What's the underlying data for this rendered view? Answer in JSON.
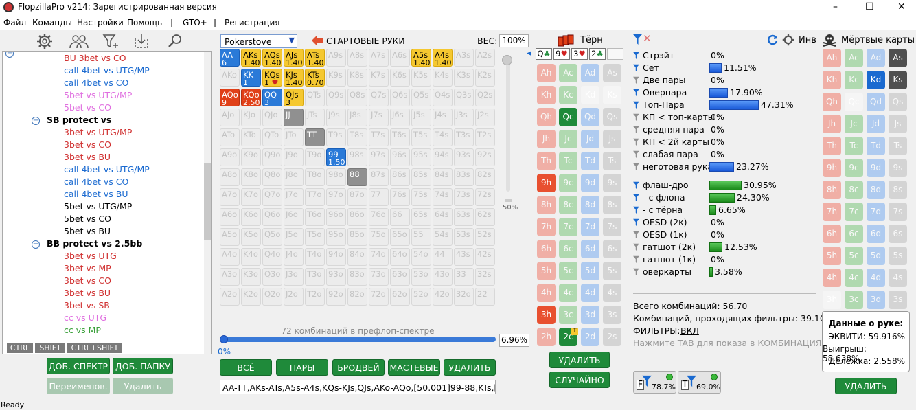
{
  "window": {
    "title": "FlopzillaPro v214: Зарегистрированная версия",
    "controls": [
      "–",
      "☐",
      "✕"
    ]
  },
  "menu": [
    "Файл",
    "Команды",
    "Настройки",
    "Помощь",
    "|",
    "GTO+",
    "|",
    "Регистрация"
  ],
  "tree": {
    "rows": [
      {
        "text": "BU 3bet vs CO",
        "color": "#d03030",
        "indent": 2
      },
      {
        "text": "call 4bet vs UTG/MP",
        "color": "#1a6ad0",
        "indent": 2
      },
      {
        "text": "call 4bet vs CO",
        "color": "#1a6ad0",
        "indent": 2
      },
      {
        "text": "5bet vs UTG/MP",
        "color": "#e070e0",
        "indent": 2
      },
      {
        "text": "5bet vs CO",
        "color": "#e070e0",
        "indent": 2
      },
      {
        "text": "SB protect vs",
        "color": "#000000",
        "indent": 1,
        "header": true
      },
      {
        "text": "3bet vs UTG/MP",
        "color": "#d03030",
        "indent": 2
      },
      {
        "text": "3bet vs CO",
        "color": "#d03030",
        "indent": 2
      },
      {
        "text": "3bet vs BU",
        "color": "#d03030",
        "indent": 2
      },
      {
        "text": "call 4bet vs UTG/MP",
        "color": "#1a6ad0",
        "indent": 2
      },
      {
        "text": "call 4bet vs CO",
        "color": "#1a6ad0",
        "indent": 2
      },
      {
        "text": "call 4bet vs BU",
        "color": "#1a6ad0",
        "indent": 2
      },
      {
        "text": "5bet vs UTG/MP",
        "color": "#000000",
        "indent": 2
      },
      {
        "text": "5bet vs CO",
        "color": "#000000",
        "indent": 2
      },
      {
        "text": "5bet vs BU",
        "color": "#000000",
        "indent": 2
      },
      {
        "text": "BB protect vs 2.5bb",
        "color": "#000000",
        "indent": 1,
        "header": true
      },
      {
        "text": "3bet vs UTG",
        "color": "#d03030",
        "indent": 2
      },
      {
        "text": "3bet vs MP",
        "color": "#d03030",
        "indent": 2
      },
      {
        "text": "3bet vs CO",
        "color": "#d03030",
        "indent": 2
      },
      {
        "text": "3bet vs BU",
        "color": "#d03030",
        "indent": 2
      },
      {
        "text": "3bet vs SB",
        "color": "#d03030",
        "indent": 2
      },
      {
        "text": "cc vs UTG",
        "color": "#e070e0",
        "indent": 2
      },
      {
        "text": "cc vs MP",
        "color": "#3aa03a",
        "indent": 2
      }
    ],
    "keys": [
      "CTRL",
      "SHIFT",
      "CTRL+SHIFT"
    ]
  },
  "left_buttons": {
    "add_spectrum": "ДОБ. СПЕКТР",
    "add_folder": "ДОБ. ПАПКУ",
    "rename": "Переименов.",
    "delete": "Удалить"
  },
  "range": {
    "source": "Pokerstove",
    "title": "СТАРТОВЫЕ РУКИ",
    "weight_label": "ВЕС:",
    "weight": "100%",
    "slider_pct": "50%",
    "combos_note": "72 комбинаций в префлоп-спектре",
    "zero": "0%",
    "pct": "6.96%",
    "buttons": [
      "ВСЁ",
      "ПАРЫ",
      "БРОДВЕЙ",
      "МАСТЕВЫЕ",
      "УДАЛИТЬ"
    ],
    "text": "AA-TT,AKs-ATs,A5s-A4s,KQs-KJs,QJs,AKo-AQo,[50.001]99-88,KTs,[",
    "cells": [
      [
        "AA|6|blue",
        "AKs|1.40|yel",
        "AQs|1.40|yel",
        "AJs|1.40|yel",
        "ATs|1.40|yel",
        "A9s",
        "A8s",
        "A7s",
        "A6s",
        "A5s|1.40|yel",
        "A4s|1.40|yel",
        "A3s",
        "A2s"
      ],
      [
        "AKo",
        "KK|1|blue",
        "KQs|1 ♥|yel",
        "KJs|1.40|yel",
        "KTs|0.70|yel",
        "K9s",
        "K8s",
        "K7s",
        "K6s",
        "K5s",
        "K4s",
        "K3s",
        "K2s"
      ],
      [
        "AQo|9|red",
        "KQo|2.50|red",
        "QQ|3|blue",
        "QJs|3|yel",
        "QTs",
        "Q9s",
        "Q8s",
        "Q7s",
        "Q6s",
        "Q5s",
        "Q4s",
        "Q3s",
        "Q2s"
      ],
      [
        "AJo",
        "KJo",
        "QJo",
        "JJ||gry",
        "JTs",
        "J9s",
        "J8s",
        "J7s",
        "J6s",
        "J5s",
        "J4s",
        "J3s",
        "J2s"
      ],
      [
        "ATo",
        "KTo",
        "QTo",
        "JTo",
        "TT||gry",
        "T9s",
        "T8s",
        "T7s",
        "T6s",
        "T5s",
        "T4s",
        "T3s",
        "T2s"
      ],
      [
        "A9o",
        "K9o",
        "Q9o",
        "J9o",
        "T9o",
        "99|1.50|blue",
        "98s",
        "97s",
        "96s",
        "95s",
        "94s",
        "93s",
        "92s"
      ],
      [
        "A8o",
        "K8o",
        "Q8o",
        "J8o",
        "T8o",
        "98o",
        "88||gry",
        "87s",
        "86s",
        "85s",
        "84s",
        "83s",
        "82s"
      ],
      [
        "A7o",
        "K7o",
        "Q7o",
        "J7o",
        "T7o",
        "97o",
        "87o",
        "77",
        "76s",
        "75s",
        "74s",
        "73s",
        "72s"
      ],
      [
        "A6o",
        "K6o",
        "Q6o",
        "J6o",
        "T6o",
        "96o",
        "86o",
        "76o",
        "66",
        "65s",
        "64s",
        "63s",
        "62s"
      ],
      [
        "A5o",
        "K5o",
        "Q5o",
        "J5o",
        "T5o",
        "95o",
        "85o",
        "75o",
        "65o",
        "55",
        "54s",
        "53s",
        "52s"
      ],
      [
        "A4o",
        "K4o",
        "Q4o",
        "J4o",
        "T4o",
        "94o",
        "84o",
        "74o",
        "64o",
        "54o",
        "44",
        "43s",
        "42s"
      ],
      [
        "A3o",
        "K3o",
        "Q3o",
        "J3o",
        "T3o",
        "93o",
        "83o",
        "73o",
        "63o",
        "53o",
        "43o",
        "33",
        "32s"
      ],
      [
        "A2o",
        "K2o",
        "Q2o",
        "J2o",
        "T2o",
        "92o",
        "82o",
        "72o",
        "62o",
        "52o",
        "42o",
        "32o",
        "22"
      ]
    ]
  },
  "turn": {
    "title": "Тёрн",
    "board": [
      "Q♣",
      "9♥",
      "3♥",
      "2♣"
    ],
    "ranks": [
      "A",
      "K",
      "Q",
      "J",
      "T",
      "9",
      "8",
      "7",
      "6",
      "5",
      "4",
      "3",
      "2"
    ],
    "suits": [
      "h",
      "c",
      "d",
      "s"
    ],
    "states": [
      [
        "s",
        "s",
        "s",
        "s"
      ],
      [
        "s",
        "s",
        "e",
        "e"
      ],
      [
        "s",
        "r",
        "s",
        "s"
      ],
      [
        "s",
        "s",
        "s",
        "s"
      ],
      [
        "s",
        "s",
        "s",
        "s"
      ],
      [
        "r",
        "s",
        "s",
        "s"
      ],
      [
        "s",
        "s",
        "s",
        "s"
      ],
      [
        "s",
        "s",
        "s",
        "s"
      ],
      [
        "s",
        "s",
        "s",
        "s"
      ],
      [
        "s",
        "s",
        "s",
        "s"
      ],
      [
        "s",
        "s",
        "s",
        "s"
      ],
      [
        "r",
        "s",
        "s",
        "s"
      ],
      [
        "s",
        "r",
        "s",
        "s"
      ]
    ],
    "t_badge": "T",
    "delete": "УДАЛИТЬ",
    "random": "СЛУЧАЙНО"
  },
  "stats": {
    "inv_label": "Инв",
    "dead_title": "Мёртвые карты",
    "made": [
      {
        "label": "Стрэйт",
        "val": "0%",
        "pct": 0,
        "f": "blue"
      },
      {
        "label": "Сет",
        "val": "11.51%",
        "pct": 11.51,
        "f": "blue"
      },
      {
        "label": "Две пары",
        "val": "0%",
        "pct": 0,
        "f": "grey"
      },
      {
        "label": "Оверпара",
        "val": "17.90%",
        "pct": 17.9,
        "f": "blue"
      },
      {
        "label": "Топ-Пара",
        "val": "47.31%",
        "pct": 47.31,
        "f": "blue"
      },
      {
        "label": "КП < топ-карты",
        "val": "0%",
        "pct": 0,
        "f": "grey"
      },
      {
        "label": "средняя пара",
        "val": "0%",
        "pct": 0,
        "f": "grey"
      },
      {
        "label": "КП < 2й карты",
        "val": "0%",
        "pct": 0,
        "f": "grey"
      },
      {
        "label": "слабая пара",
        "val": "0%",
        "pct": 0,
        "f": "grey"
      },
      {
        "label": "неготовая рука",
        "val": "23.27%",
        "pct": 23.27,
        "f": "grey"
      }
    ],
    "draws": [
      {
        "label": "флаш-дро",
        "val": "30.95%",
        "pct": 30.95,
        "f": "blue"
      },
      {
        "label": "- с флопа",
        "val": "24.30%",
        "pct": 24.3,
        "f": "blue"
      },
      {
        "label": "- с тёрна",
        "val": "6.65%",
        "pct": 6.65,
        "f": "blue"
      },
      {
        "label": "OESD (2к)",
        "val": "0%",
        "pct": 0,
        "f": "blue"
      },
      {
        "label": "OESD (1к)",
        "val": "0%",
        "pct": 0,
        "f": "grey"
      },
      {
        "label": "гатшот (2к)",
        "val": "12.53%",
        "pct": 12.53,
        "f": "grey"
      },
      {
        "label": "гатшот (1к)",
        "val": "0%",
        "pct": 0,
        "f": "grey"
      },
      {
        "label": "оверкарты",
        "val": "3.58%",
        "pct": 3.58,
        "f": "grey"
      }
    ],
    "total": "Всего комбинаций: 56.70",
    "passing": "Комбинаций, проходящих фильтры: 39.10",
    "filters_label": "ФИЛЬТРЫ:",
    "filters_val": "ВКЛ",
    "hint": "Нажмите TAB для показа в КОМБИНАЦИЯХ",
    "f_pct": "78.7%",
    "t_pct": "69.0%",
    "f_label": "F",
    "t_label": "T"
  },
  "dead": {
    "states": [
      [
        "s",
        "s",
        "s",
        "r"
      ],
      [
        "s",
        "s",
        "r",
        "r"
      ],
      [
        "s",
        "e",
        "s",
        "s"
      ],
      [
        "s",
        "s",
        "s",
        "s"
      ],
      [
        "s",
        "s",
        "s",
        "s"
      ],
      [
        "s",
        "s",
        "s",
        "s"
      ],
      [
        "s",
        "s",
        "s",
        "s"
      ],
      [
        "s",
        "s",
        "s",
        "s"
      ],
      [
        "s",
        "s",
        "s",
        "s"
      ],
      [
        "s",
        "s",
        "s",
        "s"
      ],
      [
        "s",
        "s",
        "s",
        "s"
      ],
      [
        "e",
        "s",
        "s",
        "s"
      ],
      [
        "s",
        "e",
        "s",
        "s"
      ]
    ],
    "hand_title": "Данные о руке:",
    "equity": "ЭКВИТИ: 59.916%",
    "win": "Выигрыш: 58.638%",
    "tie": "Делёжка: 2.558%",
    "delete": "УДАЛИТЬ"
  },
  "status": "Ready"
}
